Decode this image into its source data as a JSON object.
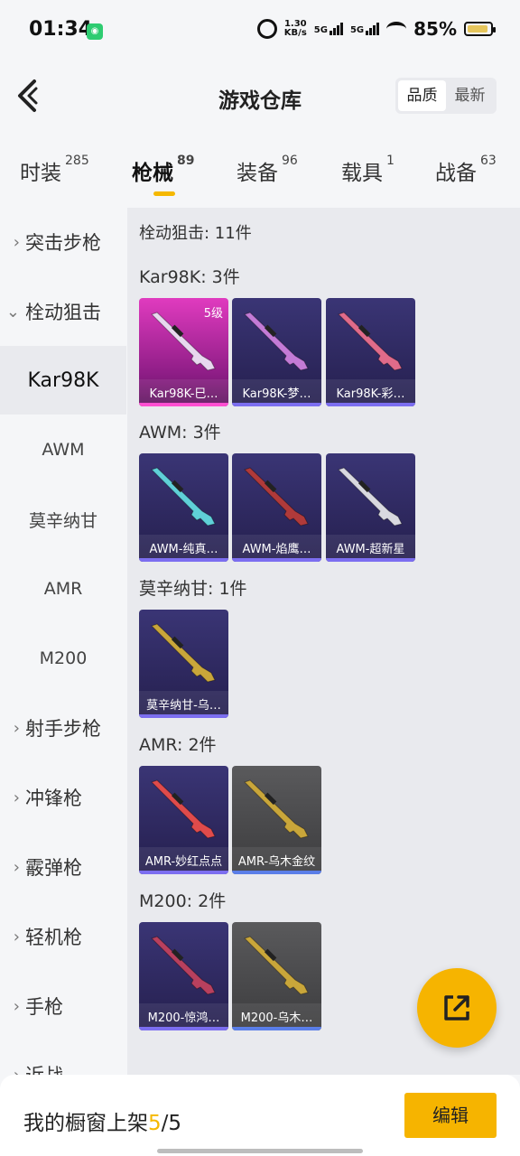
{
  "status_bar": {
    "time": "01:34",
    "speed_value": "1.30",
    "speed_unit": "KB/s",
    "net1": "5G",
    "net2": "5G",
    "battery": "85%"
  },
  "header": {
    "title": "游戏仓库",
    "sort_options": [
      "品质",
      "最新"
    ],
    "sort_selected": "品质"
  },
  "tabs": [
    {
      "label": "时装",
      "count": "285"
    },
    {
      "label": "枪械",
      "count": "89",
      "active": true
    },
    {
      "label": "装备",
      "count": "96"
    },
    {
      "label": "载具",
      "count": "1"
    },
    {
      "label": "战备",
      "count": "63"
    }
  ],
  "sidebar": [
    {
      "label": "突击步枪",
      "type": "category",
      "expanded": false
    },
    {
      "label": "栓动狙击",
      "type": "category",
      "expanded": true
    },
    {
      "label": "Kar98K",
      "type": "sub",
      "selected": true
    },
    {
      "label": "AWM",
      "type": "sub"
    },
    {
      "label": "莫辛纳甘",
      "type": "sub"
    },
    {
      "label": "AMR",
      "type": "sub"
    },
    {
      "label": "M200",
      "type": "sub"
    },
    {
      "label": "射手步枪",
      "type": "category"
    },
    {
      "label": "冲锋枪",
      "type": "category"
    },
    {
      "label": "霰弹枪",
      "type": "category"
    },
    {
      "label": "轻机枪",
      "type": "category"
    },
    {
      "label": "手枪",
      "type": "category"
    },
    {
      "label": "近战",
      "type": "category"
    }
  ],
  "content": {
    "total": "栓动狙击: 11件",
    "groups": [
      {
        "title": "Kar98K: 3件",
        "items": [
          {
            "name": "Kar98K-巳…",
            "rarity": "pink",
            "level": "5级",
            "gun_color": "#e8d8ef"
          },
          {
            "name": "Kar98K-梦…",
            "rarity": "purple",
            "gun_color": "#c37bd6"
          },
          {
            "name": "Kar98K-彩…",
            "rarity": "purple",
            "gun_color": "#e06b8a"
          }
        ]
      },
      {
        "title": "AWM: 3件",
        "items": [
          {
            "name": "AWM-纯真…",
            "rarity": "purple",
            "gun_color": "#5fd0d8"
          },
          {
            "name": "AWM-焰鹰…",
            "rarity": "purple",
            "gun_color": "#b03a3a"
          },
          {
            "name": "AWM-超新星",
            "rarity": "purple",
            "gun_color": "#d9d9e0"
          }
        ]
      },
      {
        "title": "莫辛纳甘: 1件",
        "items": [
          {
            "name": "莫辛纳甘-乌…",
            "rarity": "purple",
            "gun_color": "#c9a63a"
          }
        ]
      },
      {
        "title": "AMR: 2件",
        "items": [
          {
            "name": "AMR-妙红点点",
            "rarity": "purple",
            "gun_color": "#e04b4b"
          },
          {
            "name": "AMR-乌木金纹",
            "rarity": "gray",
            "gun_color": "#c9a63a"
          }
        ]
      },
      {
        "title": "M200: 2件",
        "items": [
          {
            "name": "M200-惊鸿…",
            "rarity": "purple",
            "gun_color": "#b8405e"
          },
          {
            "name": "M200-乌木…",
            "rarity": "gray",
            "gun_color": "#c9a63a"
          }
        ]
      }
    ]
  },
  "bottom_bar": {
    "showcase_label": "我的橱窗上架",
    "showcase_current": "5",
    "showcase_total": "/5",
    "edit_label": "编辑"
  },
  "colors": {
    "accent": "#f6b400",
    "rarity_pink": "#e03bbf",
    "rarity_purple": "#3a3575",
    "rarity_gray": "#5a5a5c"
  },
  "icons": {
    "back": "back-arrow-icon",
    "share": "share-icon",
    "expand": "chevron-right-icon",
    "collapse": "chevron-down-icon"
  }
}
